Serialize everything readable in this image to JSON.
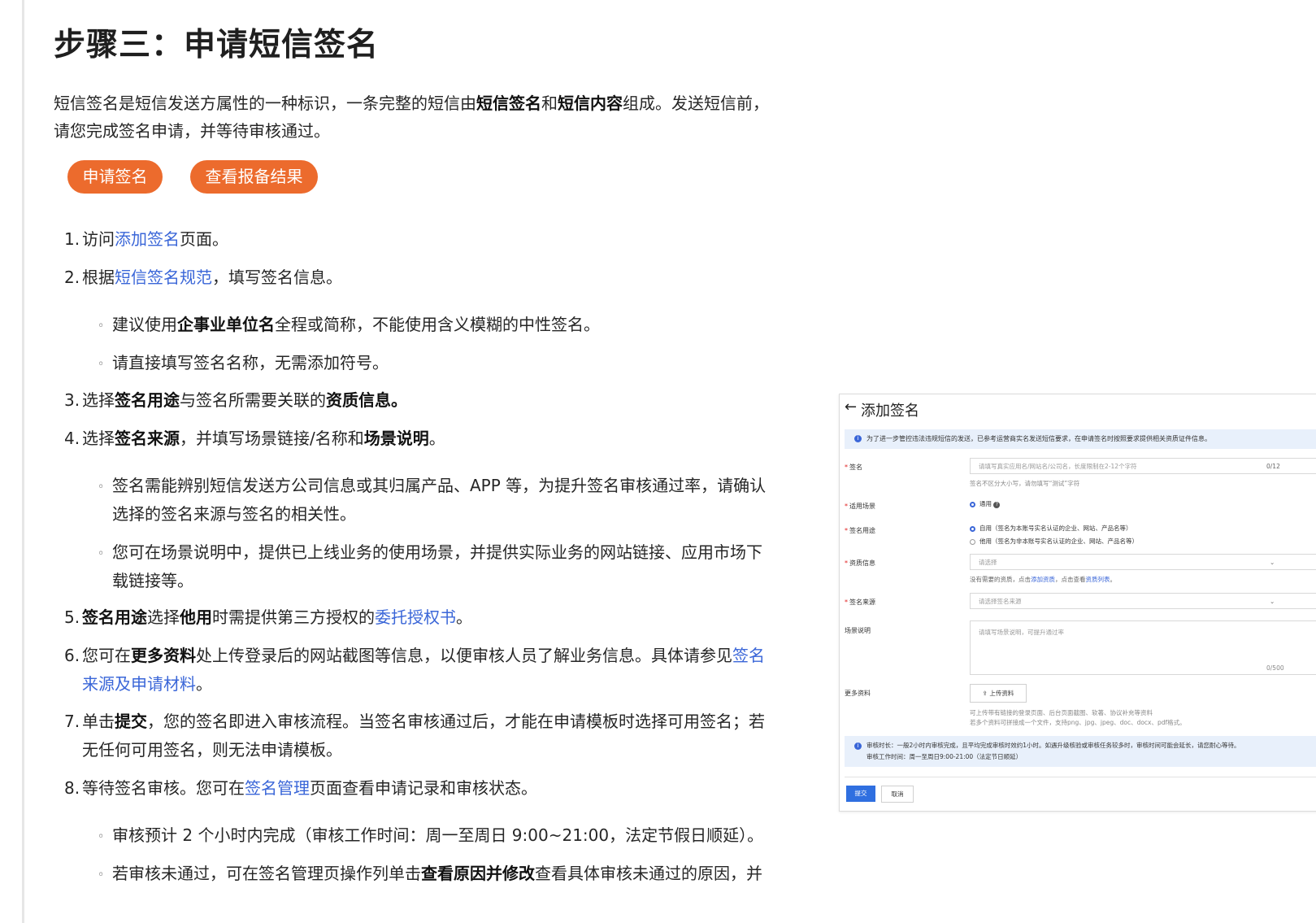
{
  "title": "步骤三：申请短信签名",
  "intro": {
    "t1": "短信签名是短信发送方属性的一种标识，一条完整的短信由",
    "b1": "短信签名",
    "t2": "和",
    "b2": "短信内容",
    "t3": "组成。发送短信前，",
    "t4": "请您完成签名申请，并等待审核通过。"
  },
  "buttons": {
    "apply": "申请签名",
    "view": "查看报备结果"
  },
  "steps": {
    "s1": {
      "num": "1.",
      "pre": "访问",
      "link": "添加签名",
      "post": "页面。"
    },
    "s2": {
      "num": "2.",
      "pre": "根据",
      "link": "短信签名规范",
      "post": "，填写签名信息。"
    },
    "s2b1": {
      "pre": "建议使用",
      "bold": "企事业单位名",
      "post": "全程或简称，不能使用含义模糊的中性签名。"
    },
    "s2b2": {
      "text": "请直接填写签名名称，无需添加符号。"
    },
    "s3": {
      "num": "3.",
      "pre": "选择",
      "b1": "签名用途",
      "mid": "与签名所需要关联的",
      "b2": "资质信息",
      "post": "。"
    },
    "s4": {
      "num": "4.",
      "pre": "选择",
      "b1": "签名来源",
      "mid": "，并填写场景链接/名称和",
      "b2": "场景说明",
      "post": "。"
    },
    "s4b1": {
      "line1": "签名需能辨别短信发送方公司信息或其归属产品、APP 等，为提升签名审核通过率，请确认",
      "line2": "选择的签名来源与签名的相关性。"
    },
    "s4b2": {
      "line1": "您可在场景说明中，提供已上线业务的使用场景，并提供实际业务的网站链接、应用市场下",
      "line2": "载链接等。"
    },
    "s5": {
      "num": "5.",
      "b1": "签名用途",
      "mid1": "选择",
      "b2": "他用",
      "mid2": "时需提供第三方授权的",
      "link": "委托授权书",
      "post": "。"
    },
    "s6": {
      "num": "6.",
      "pre": "您可在",
      "b1": "更多资料",
      "mid": "处上传登录后的网站截图等信息，以便审核人员了解业务信息。具体请参见",
      "link1": "签名",
      "link2": "来源及申请材料",
      "post": "。"
    },
    "s7": {
      "num": "7.",
      "pre": "单击",
      "b1": "提交",
      "mid": "，您的签名即进入审核流程。当签名审核通过后，才能在申请模板时选择可用签名；若",
      "line2": "无任何可用签名，则无法申请模板。"
    },
    "s8": {
      "num": "8.",
      "pre": "等待签名审核。您可在",
      "link": "签名管理",
      "post": "页面查看申请记录和审核状态。"
    },
    "s8b1": {
      "text": "审核预计 2 个小时内完成（审核工作时间：周一至周日 9:00~21:00，法定节假日顺延）。"
    },
    "s8b2": {
      "pre": "若审核未通过，可在签名管理页操作列单击",
      "bold": "查看原因并修改",
      "post": "查看具体审核未通过的原因，并"
    }
  },
  "screenshot": {
    "title": "添加签名",
    "back_icon": "arrow-left-icon",
    "notice": "为了进一步管控违法违规短信的发送，已参考运营商实名发送短信要求，在申请签名时按照要求提供相关资质证件信息。",
    "sign_label": "签名",
    "sign_placeholder": "请填写真实应用名/网站名/公司名，长度限制在2-12个字符",
    "sign_counter": "0/12",
    "sign_hint": "签名不区分大小写，请勿填写“测试”字符",
    "scene_label": "适用场景",
    "scene_option": "通用",
    "usage_label": "签名用途",
    "usage_self": "自用（签名为本账号实名认证的企业、网站、产品名等）",
    "usage_other": "他用（签名为非本账号实名认证的企业、网站、产品名等）",
    "qual_label": "资质信息",
    "qual_placeholder": "请选择",
    "qual_hint_pre": "没有需要的资质，点击",
    "qual_hint_link1": "添加资质",
    "qual_hint_mid": "，点击查看",
    "qual_hint_link2": "资质列表",
    "qual_hint_post": "。",
    "source_label": "签名来源",
    "source_placeholder": "请选择签名来源",
    "desc_label": "场景说明",
    "desc_placeholder": "请填写场景说明，可提升通过率",
    "desc_counter": "0/500",
    "more_label": "更多资料",
    "upload_label": "上传资料",
    "more_hint1": "可上传带有链接的登录页面、后台页面截图、软著、协议补充等资料",
    "more_hint2": "若多个资料可拼接成一个文件，支持png、jpg、jpeg、doc、docx、pdf格式。",
    "audit_line1": "审核时长：一般2小时内审核完成，且平均完成审核时效约1小时。如遇升级核验或审核任务较多时，审核时间可能会延长，请您耐心等待。",
    "audit_line2": "审核工作时间：周一至周日9:00-21:00（法定节日顺延）",
    "submit": "提交",
    "cancel": "取消"
  }
}
